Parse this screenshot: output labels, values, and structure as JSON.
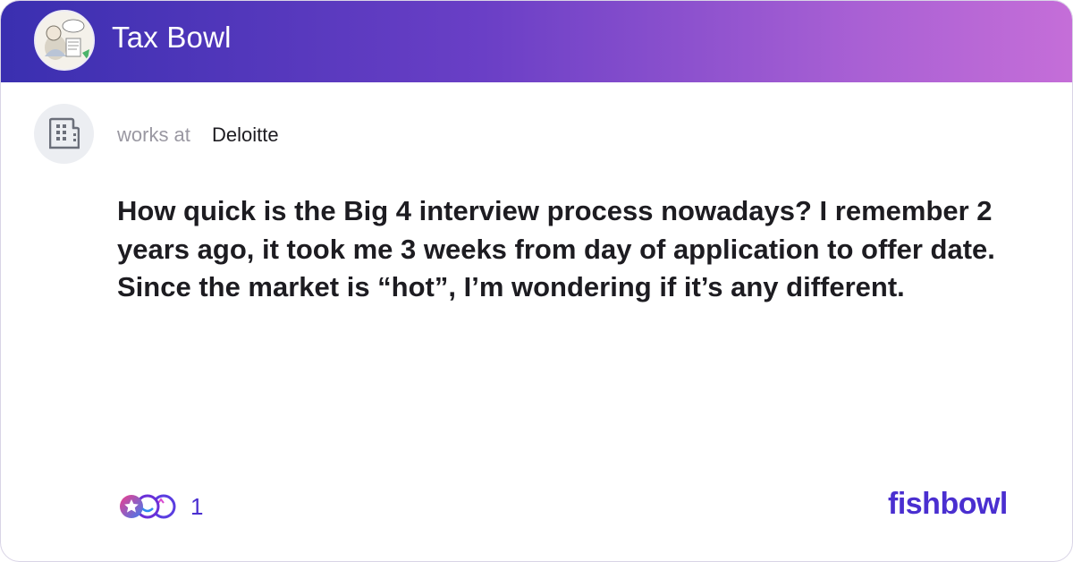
{
  "header": {
    "bowl_name": "Tax Bowl",
    "avatar_icon": "bowl-cartoon-avatar-icon",
    "gradient_start": "#3a2fb0",
    "gradient_end": "#c56ed8"
  },
  "author": {
    "prefix": "works at",
    "company": "Deloitte",
    "avatar_icon": "building-icon"
  },
  "post": {
    "body": "How quick is the Big 4 interview process nowadays? I remember 2 years ago, it took me 3 weeks from day of application to offer date. Since the market is “hot”, I’m wondering if it’s any different."
  },
  "footer": {
    "reaction_icon": "reaction-faces-icon",
    "reaction_count": "1",
    "brand": "fishbowl",
    "brand_color": "#4a2fd0"
  }
}
